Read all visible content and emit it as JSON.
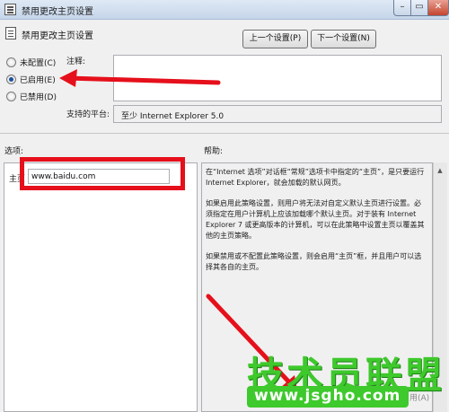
{
  "window": {
    "title": "禁用更改主页设置",
    "minimize": "–",
    "maximize": "▭",
    "close": "✕"
  },
  "header": {
    "policy_name": "禁用更改主页设置",
    "prev_button": "上一个设置(P)",
    "next_button": "下一个设置(N)"
  },
  "state": {
    "options": [
      {
        "label": "未配置(C)",
        "checked": false
      },
      {
        "label": "已启用(E)",
        "checked": true
      },
      {
        "label": "已禁用(D)",
        "checked": false
      }
    ]
  },
  "comment": {
    "label": "注释:",
    "value": ""
  },
  "platform": {
    "label": "支持的平台:",
    "value": "至少 Internet Explorer 5.0"
  },
  "options_section": {
    "label": "选项:",
    "home_label": "主页",
    "home_value": "www.baidu.com"
  },
  "help_section": {
    "label": "帮助:",
    "paragraphs": [
      "在“Internet 选项”对话框“常规”选项卡中指定的“主页”，是只要运行 Internet Explorer，就会加载的默认网页。",
      "如果启用此策略设置，则用户将无法对自定义默认主页进行设置。必须指定在用户计算机上应该加载哪个默认主页。对于装有 Internet Explorer 7 或更高版本的计算机，可以在此策略中设置主页以覆盖其他的主页策略。",
      "如果禁用或不配置此策略设置，则会启用“主页”框，并且用户可以选择其各自的主页。"
    ],
    "scroll_up": "▲"
  },
  "footer": {
    "apply_remnant": "用(A)"
  },
  "watermark": {
    "brand": "技术员联盟",
    "url": "www.jsgho.com"
  },
  "colors": {
    "annotation_red": "#e5101b",
    "watermark_green": "#3ec92c",
    "radio_selected": "#1c4f9c"
  }
}
